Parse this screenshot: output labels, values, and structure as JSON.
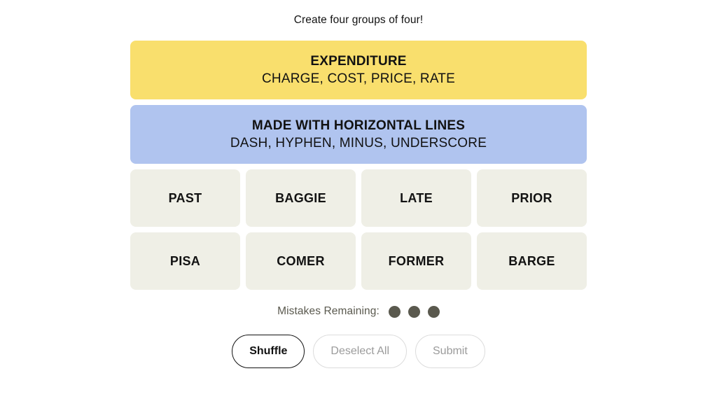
{
  "instructions": "Create four groups of four!",
  "colors": {
    "page_background": "#ffffff",
    "tile_background": "#efefe6",
    "yellow_category": "#f9df6d",
    "blue_category": "#b0c4ef",
    "text_primary": "#121212",
    "mistake_dot": "#5a594e",
    "disabled_text": "#9b9b9b",
    "disabled_border": "#dcdcdc"
  },
  "solved_categories": [
    {
      "title": "EXPENDITURE",
      "members": "CHARGE, COST, PRICE, RATE",
      "color": "#f9df6d",
      "color_name": "yellow"
    },
    {
      "title": "MADE WITH HORIZONTAL LINES",
      "members": "DASH, HYPHEN, MINUS, UNDERSCORE",
      "color": "#b0c4ef",
      "color_name": "blue"
    }
  ],
  "tiles": [
    {
      "label": "PAST"
    },
    {
      "label": "BAGGIE"
    },
    {
      "label": "LATE"
    },
    {
      "label": "PRIOR"
    },
    {
      "label": "PISA"
    },
    {
      "label": "COMER"
    },
    {
      "label": "FORMER"
    },
    {
      "label": "BARGE"
    }
  ],
  "mistakes": {
    "label": "Mistakes Remaining:",
    "remaining": 3
  },
  "actions": [
    {
      "label": "Shuffle",
      "state": "enabled"
    },
    {
      "label": "Deselect All",
      "state": "disabled"
    },
    {
      "label": "Submit",
      "state": "disabled"
    }
  ]
}
